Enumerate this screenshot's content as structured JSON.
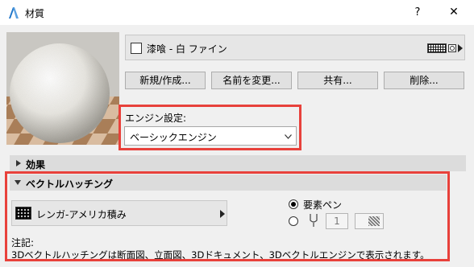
{
  "window": {
    "title": "材質",
    "help_label": "?",
    "close_label": "✕"
  },
  "material": {
    "name": "漆喰 - 白 ファイン"
  },
  "buttons": {
    "new": "新規/作成...",
    "rename": "名前を変更...",
    "share": "共有...",
    "delete": "削除..."
  },
  "engine": {
    "label": "エンジン設定:",
    "value": "ベーシックエンジン"
  },
  "sections": {
    "effects": "効果",
    "vector_hatching": "ベクトルハッチング"
  },
  "hatching": {
    "pattern_name": "レンガ-アメリカ積み",
    "option_element_pen": "要素ペン",
    "pen_number": "1"
  },
  "note": {
    "label": "注記:",
    "text": "3Dベクトルハッチングは断面図、立面図、3Dドキュメント、3Dベクトルエンジンで表示されます。"
  },
  "colors": {
    "highlight": "#e8413b",
    "accent": "#1a73c8"
  }
}
